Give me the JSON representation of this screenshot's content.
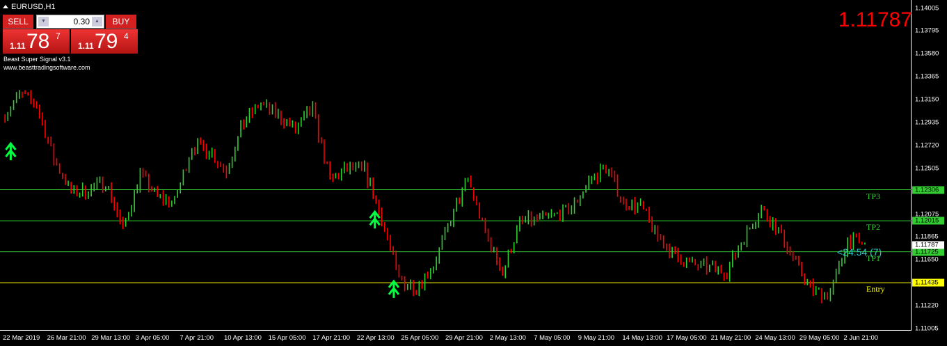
{
  "window": {
    "title": "EURUSD,H1"
  },
  "trade_panel": {
    "sell_label": "SELL",
    "buy_label": "BUY",
    "lot": "0.30",
    "bid": {
      "prefix": "1.11",
      "big": "78",
      "pip": "7"
    },
    "ask": {
      "prefix": "1.11",
      "big": "79",
      "pip": "4"
    }
  },
  "indicator": {
    "name": "Beast Super Signal v3.1",
    "url": "www.beasttradingsoftware.com"
  },
  "current_price": "1.11787",
  "timer": "<24:54 (7)",
  "colors": {
    "bull": "#32cd32",
    "bear": "#ff0000",
    "level": "#32cd32",
    "entry": "#ffff00",
    "price_big": "#ff0000",
    "arrow": "#00ff40"
  },
  "chart_data": {
    "type": "candlestick",
    "symbol": "EURUSD",
    "timeframe": "H1",
    "ylim": [
      1.11005,
      1.14005
    ],
    "y_ticks": [
      "1.14005",
      "1.13795",
      "1.13580",
      "1.13365",
      "1.13150",
      "1.12935",
      "1.12720",
      "1.12505",
      "1.12290",
      "1.12075",
      "1.11865",
      "1.11650",
      "1.11435",
      "1.11220",
      "1.11005"
    ],
    "x_ticks": [
      "22 Mar 2019",
      "26 Mar 21:00",
      "29 Mar 13:00",
      "3 Apr 05:00",
      "7 Apr 21:00",
      "10 Apr 13:00",
      "15 Apr 05:00",
      "17 Apr 21:00",
      "22 Apr 13:00",
      "25 Apr 05:00",
      "29 Apr 21:00",
      "2 May 13:00",
      "7 May 05:00",
      "9 May 21:00",
      "14 May 13:00",
      "17 May 05:00",
      "21 May 21:00",
      "24 May 13:00",
      "29 May 05:00",
      "2 Jun 21:00"
    ],
    "approx_closes": [
      1.12975,
      1.13197,
      1.13105,
      1.1259,
      1.12284,
      1.12297,
      1.12388,
      1.11932,
      1.12453,
      1.12238,
      1.12192,
      1.12714,
      1.12681,
      1.12486,
      1.12936,
      1.13118,
      1.12994,
      1.1287,
      1.13059,
      1.12388,
      1.12499,
      1.12486,
      1.12029,
      1.11462,
      1.11391,
      1.11606,
      1.12023,
      1.12408,
      1.11899,
      1.11527,
      1.11997,
      1.12029,
      1.12062,
      1.12127,
      1.12388,
      1.12518,
      1.12186,
      1.12147,
      1.11866,
      1.11677,
      1.11606,
      1.11573,
      1.1154,
      1.11866,
      1.12127,
      1.11918,
      1.11619,
      1.11345,
      1.11345,
      1.11834,
      1.11787
    ],
    "levels": [
      {
        "label": "TP3",
        "price": "1.12306",
        "type": "tp"
      },
      {
        "label": "TP2",
        "price": "1.12015",
        "type": "tp"
      },
      {
        "label": "TP1",
        "price": "1.11725",
        "type": "tp"
      },
      {
        "label": "Entry",
        "price": "1.11435",
        "type": "entry"
      }
    ],
    "signals": [
      {
        "type": "buy-arrow",
        "index": 0.5,
        "price": 1.127
      },
      {
        "type": "buy-arrow",
        "index": 21.6,
        "price": 1.1206
      },
      {
        "type": "buy-arrow",
        "index": 22.7,
        "price": 1.1141
      }
    ],
    "bid_tag": "1.11787"
  }
}
